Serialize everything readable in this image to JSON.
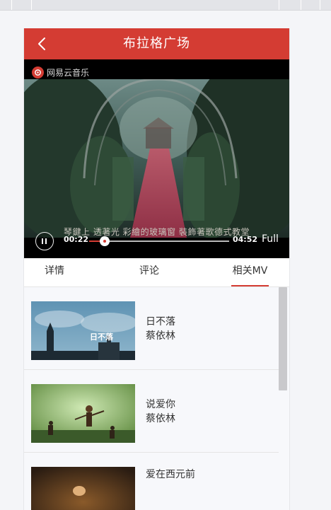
{
  "header": {
    "title": "布拉格广场",
    "back_icon": "chevron-left-icon",
    "color": "#d43c33"
  },
  "video": {
    "brand_label": "网易云音乐",
    "subtitle": "琴鍵上 透著光 彩繪的玻璃窗 裝飾著歌德式教堂",
    "current_time": "00:22",
    "total_time": "04:52",
    "progress_fraction": 0.11,
    "full_label": "Full",
    "play_state_icon": "pause-icon"
  },
  "tabs": [
    {
      "label": "详情",
      "active": false
    },
    {
      "label": "评论",
      "active": false
    },
    {
      "label": "相关MV",
      "active": true
    }
  ],
  "related_mvs": [
    {
      "title": "日不落",
      "artist": "蔡依林",
      "thumb_caption": "日不落"
    },
    {
      "title": "说爱你",
      "artist": "蔡依林",
      "thumb_caption": ""
    },
    {
      "title": "爱在西元前",
      "artist": "",
      "thumb_caption": ""
    }
  ]
}
